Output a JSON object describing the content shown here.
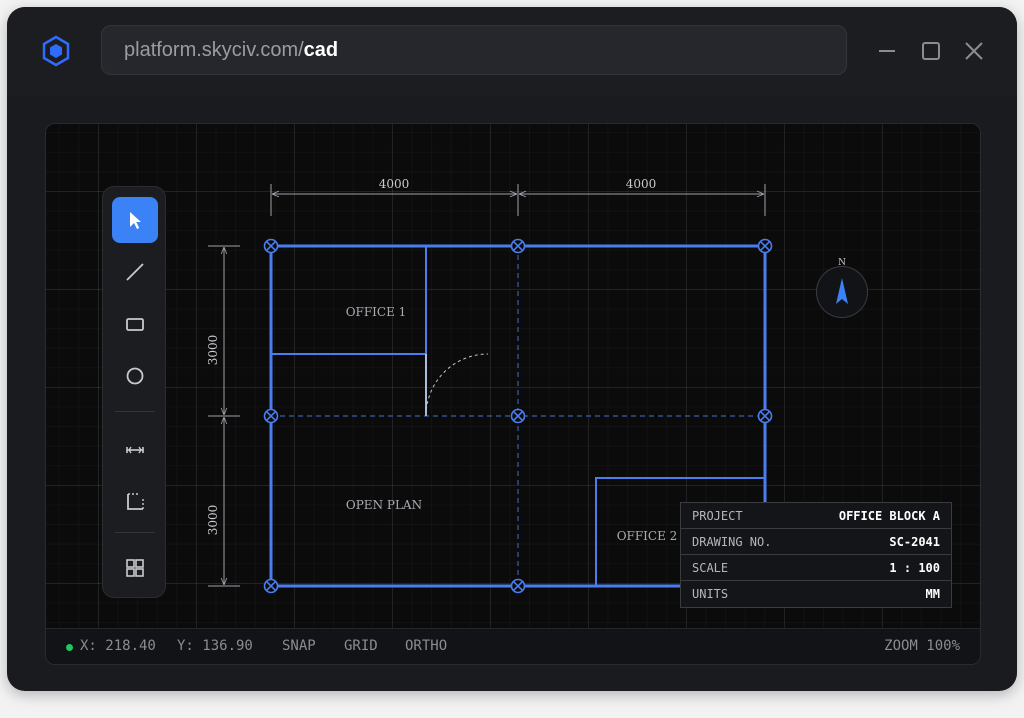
{
  "browser": {
    "url_host": "platform.skyciv.com/",
    "url_path": "cad"
  },
  "toolbar": {
    "tools": [
      {
        "name": "select",
        "icon": "cursor-arrow-icon",
        "active": true
      },
      {
        "name": "line",
        "icon": "line-icon",
        "active": false
      },
      {
        "name": "rectangle",
        "icon": "rectangle-icon",
        "active": false
      },
      {
        "name": "circle",
        "icon": "circle-icon",
        "active": false
      },
      {
        "name": "dimension",
        "icon": "dimension-icon",
        "active": false
      },
      {
        "name": "corner",
        "icon": "corner-icon",
        "active": false
      },
      {
        "name": "grid-view",
        "icon": "grid-icon",
        "active": false
      }
    ]
  },
  "drawing": {
    "dimensions": {
      "top_left": "4000",
      "top_right": "4000",
      "left_upper": "3000",
      "left_lower": "3000"
    },
    "rooms": {
      "office1": "OFFICE 1",
      "open_plan": "OPEN PLAN",
      "office2": "OFFICE 2"
    },
    "compass_label": "N"
  },
  "title_block": {
    "rows": [
      {
        "key": "PROJECT",
        "value": "OFFICE BLOCK A"
      },
      {
        "key": "DRAWING NO.",
        "value": "SC-2041"
      },
      {
        "key": "SCALE",
        "value": "1 : 100"
      },
      {
        "key": "UNITS",
        "value": "MM"
      }
    ]
  },
  "status": {
    "x": "X: 218.40",
    "y": "Y: 136.90",
    "snap": "SNAP",
    "grid": "GRID",
    "ortho": "ORTHO",
    "zoom": "ZOOM 100%"
  },
  "colors": {
    "accent": "#3b82f6",
    "wall": "#4a7ef0",
    "status_ok": "#22c55e"
  }
}
